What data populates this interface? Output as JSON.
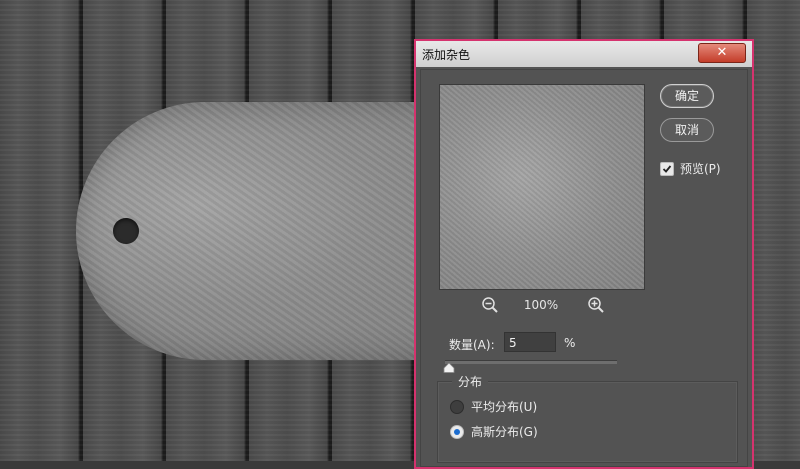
{
  "dialog": {
    "title": "添加杂色",
    "close_label": "✕",
    "ok_label": "确定",
    "cancel_label": "取消",
    "preview_checkbox": {
      "label": "预览(P)",
      "checked": true
    },
    "zoom": {
      "level": "100%",
      "zoom_out_icon": "zoom-out-icon",
      "zoom_in_icon": "zoom-in-icon"
    },
    "amount": {
      "label": "数量(A):",
      "value": "5",
      "unit": "%"
    },
    "distribution": {
      "title": "分布",
      "options": [
        {
          "label": "平均分布(U)",
          "selected": false
        },
        {
          "label": "高斯分布(G)",
          "selected": true
        }
      ]
    }
  },
  "colors": {
    "dialog_border": "#d5336e",
    "dialog_bg": "#535353",
    "radio_accent": "#1b6ccf"
  }
}
